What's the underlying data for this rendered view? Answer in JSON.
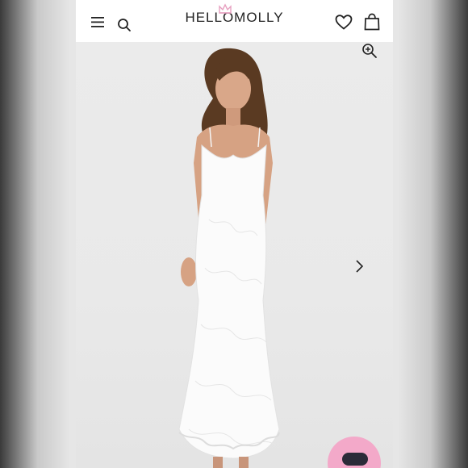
{
  "header": {
    "brand": "HELLOMOLLY",
    "icons": [
      "menu-icon",
      "search-icon",
      "heart-icon",
      "bag-icon"
    ]
  },
  "product_image": {
    "controls": [
      "zoom-icon",
      "next-image-icon"
    ]
  },
  "chat": {
    "icon": "chat-icon"
  },
  "colors": {
    "header_bg": "#ffffff",
    "brand_text": "#222222",
    "crown_pink": "#e7a0c0",
    "chat_bubble": "#f3a9c9"
  }
}
